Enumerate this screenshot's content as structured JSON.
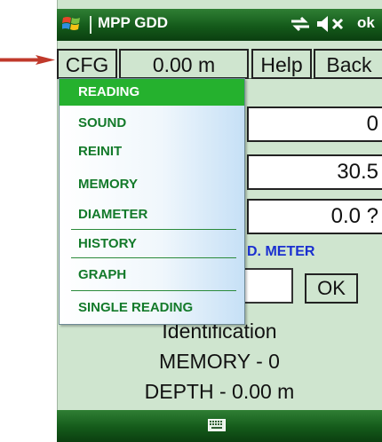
{
  "title_bar": {
    "app_title": "MPP GDD",
    "ok_label": "ok",
    "icons": [
      "windows-logo-icon",
      "connectivity-icon",
      "volume-muted-icon"
    ]
  },
  "toolbar": {
    "cfg_label": "CFG",
    "depth_value": "0.00 m",
    "help_label": "Help",
    "back_label": "Back"
  },
  "menu": {
    "items": [
      {
        "label": "READING",
        "selected": true
      },
      {
        "label": "SOUND"
      },
      {
        "label": "REINIT"
      },
      {
        "label": "MEMORY"
      },
      {
        "label": "DIAMETER"
      },
      {
        "label": "HISTORY"
      },
      {
        "label": "GRAPH"
      },
      {
        "label": "SINGLE READING"
      }
    ]
  },
  "content": {
    "field_1": "0",
    "field_2": "30.5",
    "field_3": "0.0 ?",
    "meter_label": "D. METER",
    "ok_button": "OK",
    "identification": "Identification",
    "memory_line": "MEMORY - 0",
    "depth_line": "DEPTH - 0.00 m"
  },
  "bottom_bar": {
    "icons": [
      "keyboard-icon"
    ]
  },
  "colors": {
    "bar_green": "#145a1a",
    "background": "#cfe5cf",
    "menu_text": "#137a2a",
    "menu_selected": "#25b12e",
    "meter_text": "#1a2fd0",
    "arrow": "#c0392b"
  }
}
